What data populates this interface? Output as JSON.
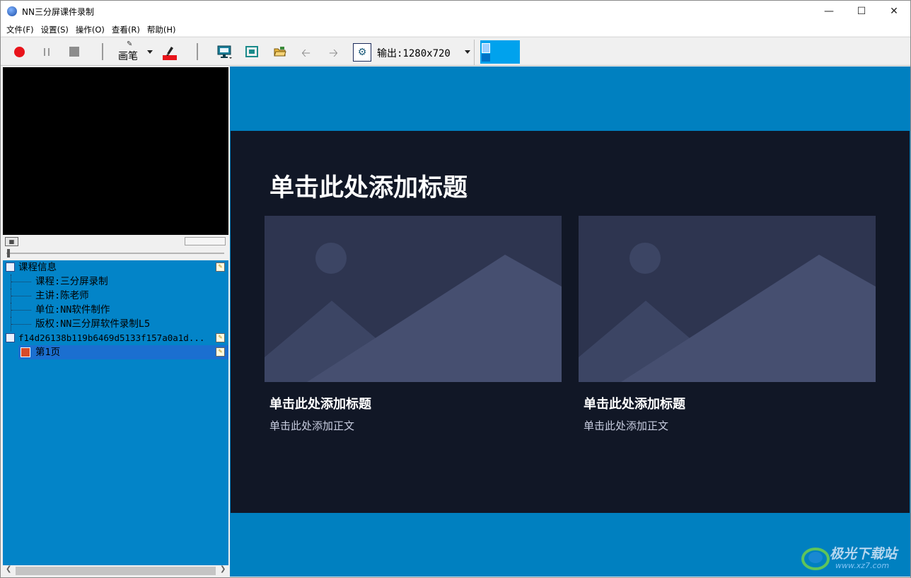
{
  "window": {
    "title": "NN三分屏课件录制"
  },
  "menu": [
    "文件(F)",
    "设置(S)",
    "操作(O)",
    "查看(R)",
    "帮助(H)"
  ],
  "toolbar": {
    "pen_label": "画笔",
    "output_label": "输出:1280x720"
  },
  "tree": {
    "course_info": "课程信息",
    "course": "课程:三分屏录制",
    "lecturer": "主讲:陈老师",
    "unit": "单位:NN软件制作",
    "copyright": "版权:NN三分屏软件录制L5",
    "file": "f14d26138b119b6469d5133f157a0a1d...",
    "page": "第1页"
  },
  "slide": {
    "title": "单击此处添加标题",
    "cards": [
      {
        "title": "单击此处添加标题",
        "body": "单击此处添加正文"
      },
      {
        "title": "单击此处添加标题",
        "body": "单击此处添加正文"
      }
    ]
  },
  "watermark": {
    "text": "极光下载站",
    "sub": "www.xz7.com"
  },
  "colors": {
    "stage": "#0080c0",
    "slide_bg": "#111726",
    "tree_bg": "#0384c8",
    "accent": "#00a2ed"
  }
}
